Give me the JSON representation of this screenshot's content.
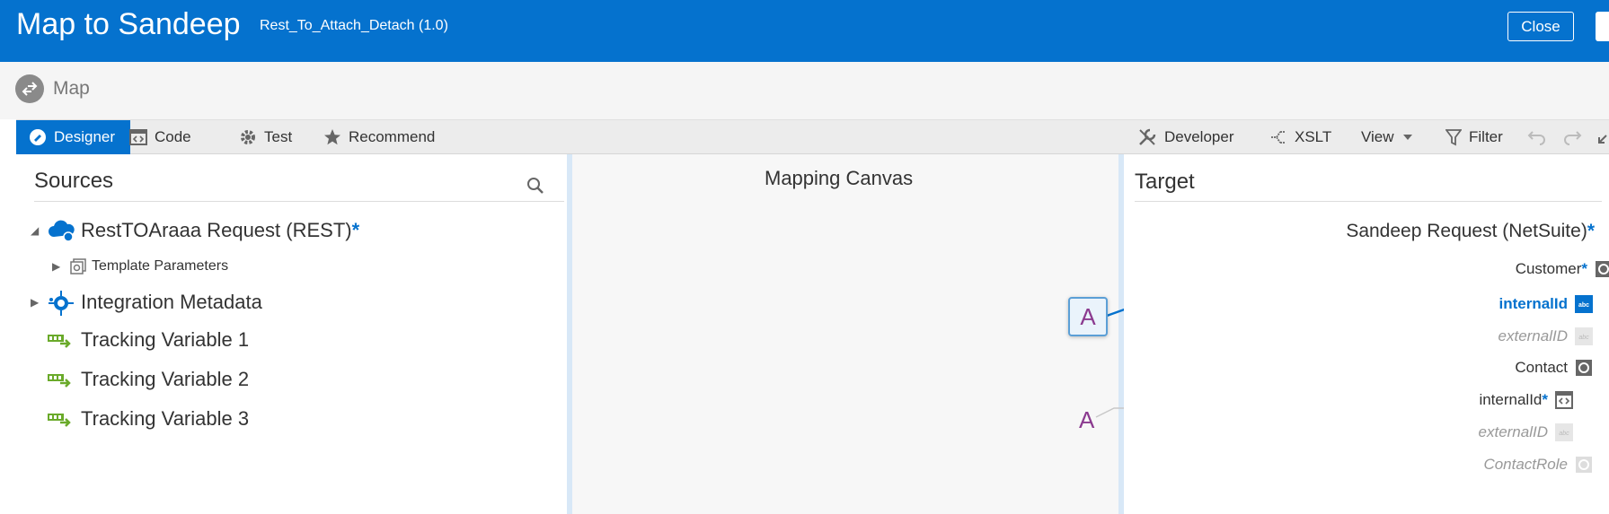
{
  "header": {
    "title": "Map to Sandeep",
    "subtitle": "Rest_To_Attach_Detach (1.0)",
    "close_label": "Close"
  },
  "maprow": {
    "label": "Map"
  },
  "toolbar": {
    "designer": "Designer",
    "code": "Code",
    "test": "Test",
    "recommend": "Recommend",
    "developer": "Developer",
    "xslt": "XSLT",
    "view": "View",
    "filter": "Filter"
  },
  "sources": {
    "title": "Sources",
    "nodes": [
      {
        "label": "RestTOAraaa Request (REST)",
        "required": "*"
      },
      {
        "label": "Template Parameters"
      },
      {
        "label": "Integration Metadata"
      },
      {
        "label": "Tracking Variable 1"
      },
      {
        "label": "Tracking Variable 2"
      },
      {
        "label": "Tracking Variable 3"
      }
    ]
  },
  "canvas": {
    "title": "Mapping Canvas",
    "function_1": "A",
    "function_2": "A"
  },
  "target": {
    "title": "Target",
    "nodes": [
      {
        "label": "Sandeep Request (NetSuite)",
        "required": "*"
      },
      {
        "label": "Customer",
        "required": "*"
      },
      {
        "label": "internalId"
      },
      {
        "label": "externalID"
      },
      {
        "label": "Contact"
      },
      {
        "label": "internalId",
        "required": "*"
      },
      {
        "label": "externalID"
      },
      {
        "label": "ContactRole"
      }
    ]
  },
  "colors": {
    "brand": "#0572ce",
    "function": "#8b3a8f",
    "tracking": "#6aaa2a"
  }
}
